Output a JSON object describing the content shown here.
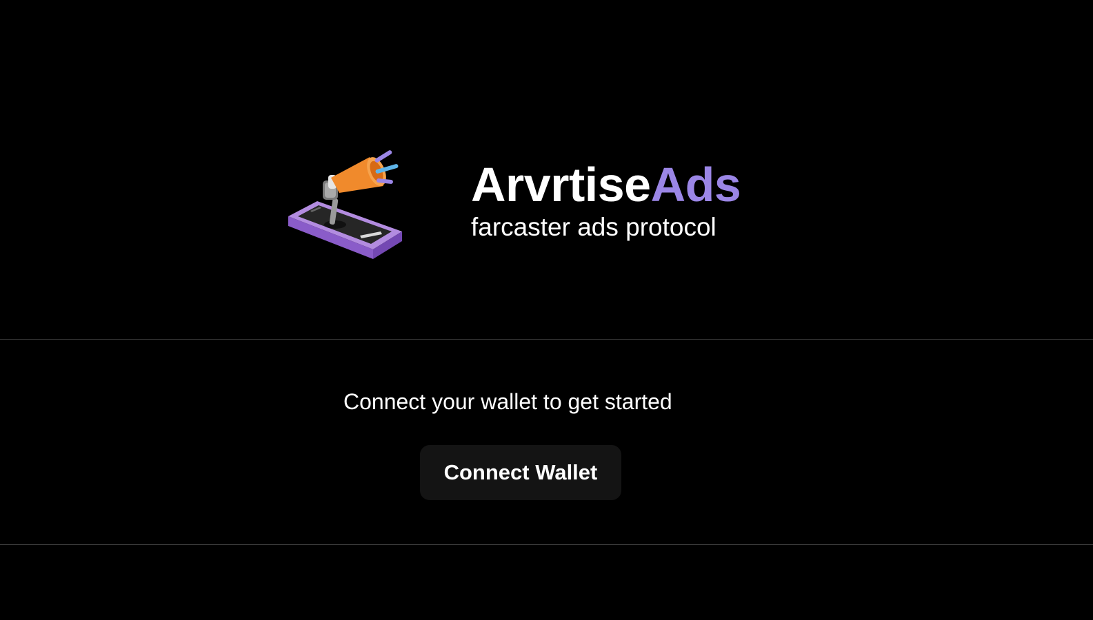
{
  "brand": {
    "name_primary": "Arvrtise",
    "name_accent": "Ads",
    "tagline": "farcaster ads protocol",
    "accent_color": "#9b86e6",
    "logo_icon": "megaphone-on-phone-icon"
  },
  "connect": {
    "prompt": "Connect your wallet to get started",
    "button_label": "Connect Wallet"
  }
}
